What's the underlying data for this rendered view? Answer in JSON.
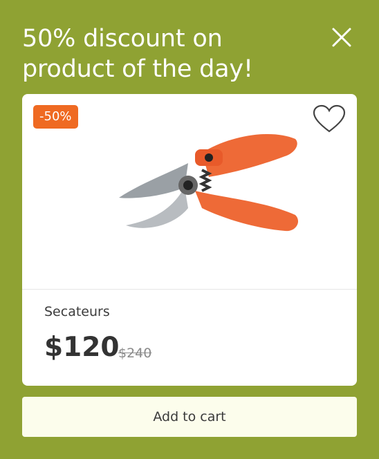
{
  "popup": {
    "title": "50% discount on product of the day!",
    "close_icon": "close-icon"
  },
  "product": {
    "discount_badge": "-50%",
    "wishlist_icon": "heart-icon",
    "name": "Secateurs",
    "price": "$120",
    "old_price": "$240"
  },
  "actions": {
    "add_to_cart_label": "Add to cart"
  },
  "colors": {
    "background": "#8fa233",
    "badge": "#ef6a22",
    "button_bg": "#fcfdec"
  }
}
